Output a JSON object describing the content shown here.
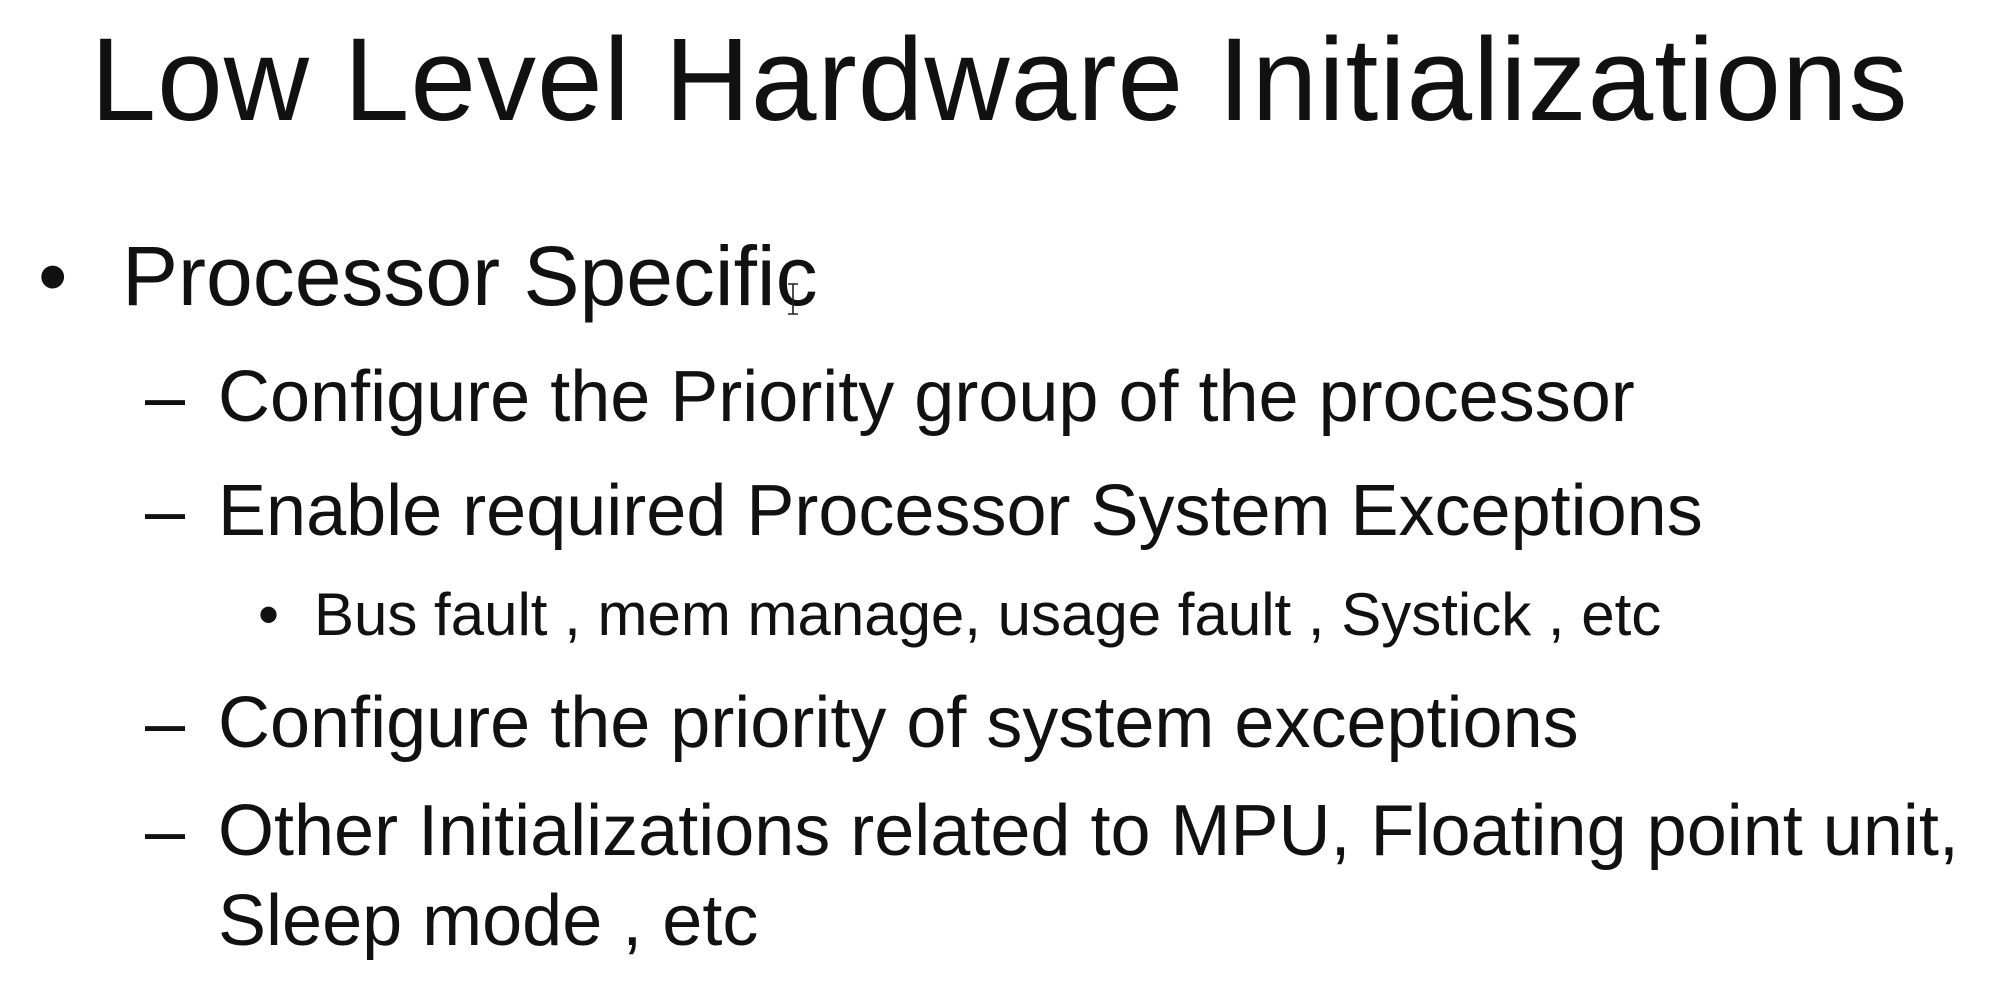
{
  "slide": {
    "title": "Low Level Hardware Initializations",
    "bullets": [
      {
        "marker": "•",
        "text": "Processor Specific"
      },
      {
        "marker": "–",
        "text": "Configure the Priority group of the processor"
      },
      {
        "marker": "–",
        "text": "Enable required Processor System Exceptions"
      },
      {
        "marker": "•",
        "text": "Bus fault , mem manage, usage fault , Systick , etc"
      },
      {
        "marker": "–",
        "text": "Configure the priority of system exceptions"
      },
      {
        "marker": "–",
        "text": "Other Initializations related to MPU, Floating point unit, Sleep mode , etc"
      }
    ]
  },
  "icons": {
    "cursor": "text-cursor-icon"
  }
}
